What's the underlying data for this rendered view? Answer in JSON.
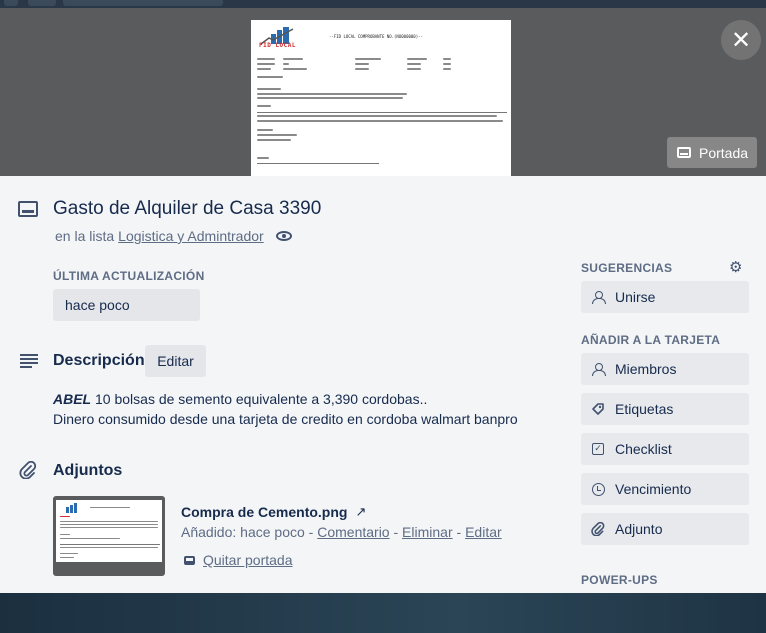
{
  "cover": {
    "doc_logo_text": "FID LOCAL",
    "doc_header": "--FID LOCAL COMPROBANTE NO.(NO000000)--",
    "portada_label": "Portada"
  },
  "card": {
    "title": "Gasto de Alquiler de Casa 3390",
    "in_list_prefix": "en la lista",
    "list_name": "Logistica y Admintrador"
  },
  "last_update": {
    "label": "ÚLTIMA ACTUALIZACIÓN",
    "value": "hace poco"
  },
  "description": {
    "title": "Descripción",
    "edit_label": "Editar",
    "line1_bold": "ABEL",
    "line1_rest": " 10 bolsas de semento equivalente a 3,390 cordobas..",
    "line2": "Dinero consumido desde una tarjeta de credito en cordoba walmart banpro"
  },
  "attachments": {
    "title": "Adjuntos",
    "items": [
      {
        "name": "Compra de Cemento.png",
        "added_prefix": "Añadido: hace poco",
        "sep": " - ",
        "comment": "Comentario",
        "delete": "Eliminar",
        "edit": "Editar",
        "remove_cover": "Quitar portada"
      }
    ]
  },
  "sidebar": {
    "suggestions_label": "SUGERENCIAS",
    "join_label": "Unirse",
    "add_to_card_label": "AÑADIR A LA TARJETA",
    "add_items": [
      "Miembros",
      "Etiquetas",
      "Checklist",
      "Vencimiento",
      "Adjunto"
    ],
    "powerups_label": "POWER-UPS"
  },
  "icons": {
    "close": "close-icon",
    "cover": "card-cover-icon",
    "watch": "eye-icon",
    "gear": "gear-icon"
  }
}
